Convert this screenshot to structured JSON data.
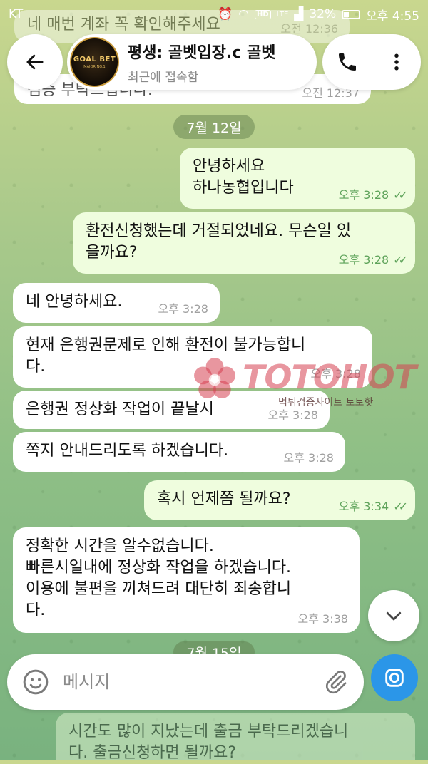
{
  "status_bar": {
    "carrier": "KT",
    "signal": "LTE",
    "battery": "32%",
    "time": "오후 4:55"
  },
  "header": {
    "chat_name": "평생: 골벳입장.c 골벳",
    "chat_status": "최근에 접속함",
    "avatar_logo": "GOAL BET",
    "avatar_sub": "MAJOR NO.1"
  },
  "partial_top": {
    "text1": "네 매번 계좌 꼭 확인해주세요",
    "time1": "오전 12:36",
    "text2": "검증 부탁드립니다.",
    "time2": "오전 12:37"
  },
  "date1": "7월 12일",
  "messages": [
    {
      "dir": "out",
      "text": "안녕하세요\n하나농협입니다",
      "time": "오후 3:28"
    },
    {
      "dir": "out",
      "text": "환전신청했는데 거절되었네요. 무슨일 있\n을까요?",
      "time": "오후 3:28"
    },
    {
      "dir": "in",
      "text": "네 안녕하세요.",
      "time": "오후 3:28"
    },
    {
      "dir": "in",
      "text": "현재 은행권문제로 인해 환전이 불가능합니\n다.",
      "time": "오후 3:28"
    },
    {
      "dir": "in",
      "text": "은행권 정상화 작업이 끝날시",
      "time": "오후 3:28"
    },
    {
      "dir": "in",
      "text": "쪽지 안내드리도록 하겠습니다.",
      "time": "오후 3:28"
    },
    {
      "dir": "out",
      "text": "혹시 언제쯤 될까요?",
      "time": "오후 3:34"
    },
    {
      "dir": "in",
      "text": "정확한 시간을 알수없습니다.\n빠른시일내에 정상화 작업을 하겠습니다.\n이용에 불편을 끼쳐드려 대단히 죄송합니\n다.",
      "time": "오후 3:38"
    }
  ],
  "date2": "7월 15일",
  "partial_bottom": {
    "text": "시간도 많이 지났는데 출금 부탁드리겠습니\n다. 출금신청하면 될까요?"
  },
  "watermark": {
    "brand": "TOTOHOT",
    "sub": "먹튀검증사이트 토토핫"
  },
  "composer": {
    "placeholder": "메시지"
  }
}
